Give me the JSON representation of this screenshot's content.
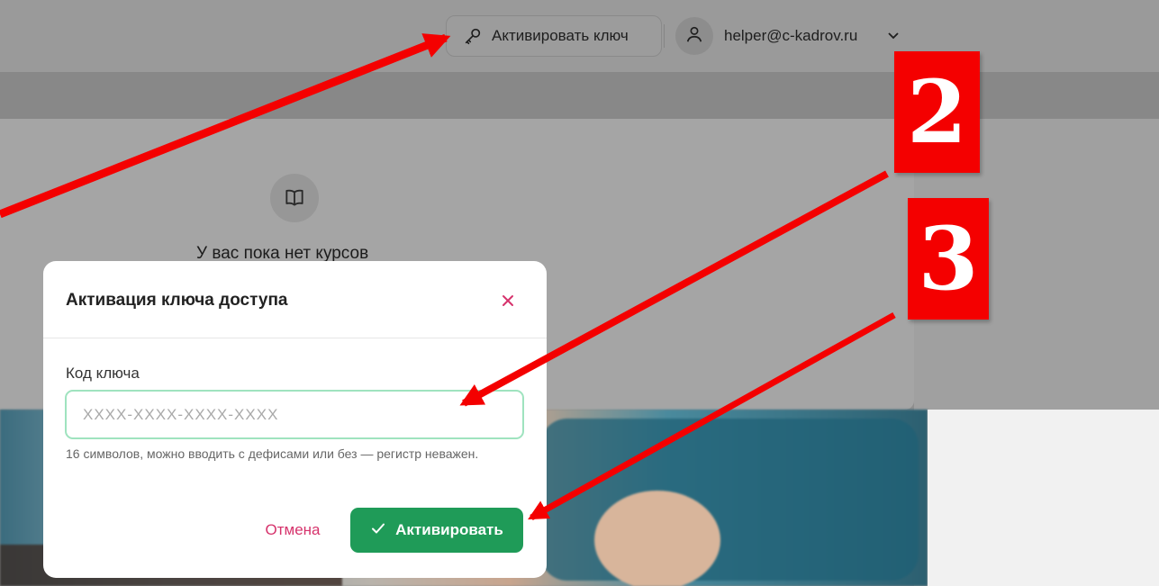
{
  "header": {
    "activate_key_label": "Активировать ключ",
    "user_email": "helper@c-kadrov.ru"
  },
  "content": {
    "empty_title": "У вас пока нет курсов"
  },
  "modal": {
    "title": "Активация ключа доступа",
    "field_label": "Код ключа",
    "input_placeholder": "XXXX-XXXX-XXXX-XXXX",
    "input_value": "",
    "hint": "16 символов, можно вводить с дефисами или без — регистр неважен.",
    "cancel_label": "Отмена",
    "activate_label": "Активировать"
  },
  "annotations": {
    "badge_2": "2",
    "badge_3": "3"
  },
  "colors": {
    "accent_green": "#1f9b58",
    "input_border": "#9fe3bf",
    "cancel_pink": "#d6336c",
    "annotation_red": "#f40000"
  },
  "icons": [
    "key-icon",
    "user-icon",
    "chevron-down-icon",
    "book-icon",
    "close-icon",
    "check-icon"
  ]
}
